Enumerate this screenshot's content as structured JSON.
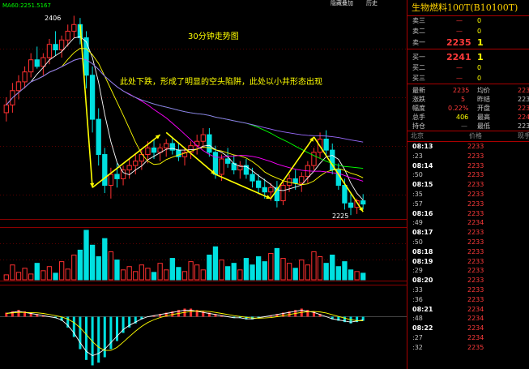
{
  "main_chart": {
    "ma_label": "MA60:2251.5167",
    "period_label": "30分钟走势图",
    "note": "此处下跌，形成了明显的空头陷阱，此处以小井形态出现",
    "high_label": "2406",
    "low_label": "2225",
    "top_buttons": [
      "隐藏叠加",
      "历史"
    ]
  },
  "chart_data": {
    "type": "candlestick",
    "title": "30分钟走势图",
    "annotations": [
      "此处下跌，形成了明显的空头陷阱，此处以小井形态出现",
      "2406",
      "2225",
      "MA60:2251.5167"
    ],
    "ohlc": [
      [
        2318,
        2332,
        2310,
        2325
      ],
      [
        2325,
        2345,
        2318,
        2338
      ],
      [
        2338,
        2352,
        2330,
        2346
      ],
      [
        2346,
        2360,
        2340,
        2355
      ],
      [
        2355,
        2372,
        2350,
        2366
      ],
      [
        2366,
        2378,
        2358,
        2360
      ],
      [
        2360,
        2372,
        2352,
        2368
      ],
      [
        2368,
        2385,
        2362,
        2380
      ],
      [
        2380,
        2392,
        2370,
        2375
      ],
      [
        2375,
        2388,
        2368,
        2384
      ],
      [
        2384,
        2398,
        2378,
        2392
      ],
      [
        2392,
        2406,
        2386,
        2398
      ],
      [
        2398,
        2404,
        2380,
        2386
      ],
      [
        2386,
        2392,
        2340,
        2352
      ],
      [
        2352,
        2360,
        2300,
        2312
      ],
      [
        2312,
        2322,
        2270,
        2280
      ],
      [
        2280,
        2286,
        2245,
        2252
      ],
      [
        2252,
        2268,
        2240,
        2262
      ],
      [
        2262,
        2272,
        2250,
        2258
      ],
      [
        2258,
        2270,
        2252,
        2266
      ],
      [
        2266,
        2276,
        2258,
        2270
      ],
      [
        2270,
        2280,
        2262,
        2274
      ],
      [
        2274,
        2284,
        2266,
        2280
      ],
      [
        2280,
        2292,
        2272,
        2286
      ],
      [
        2286,
        2294,
        2276,
        2282
      ],
      [
        2282,
        2290,
        2274,
        2286
      ],
      [
        2286,
        2294,
        2278,
        2290
      ],
      [
        2290,
        2296,
        2280,
        2284
      ],
      [
        2284,
        2290,
        2274,
        2278
      ],
      [
        2278,
        2286,
        2270,
        2282
      ],
      [
        2282,
        2292,
        2276,
        2288
      ],
      [
        2288,
        2298,
        2280,
        2292
      ],
      [
        2292,
        2304,
        2286,
        2298
      ],
      [
        2298,
        2304,
        2278,
        2282
      ],
      [
        2282,
        2288,
        2258,
        2262
      ],
      [
        2262,
        2280,
        2256,
        2276
      ],
      [
        2276,
        2286,
        2268,
        2272
      ],
      [
        2272,
        2280,
        2262,
        2266
      ],
      [
        2266,
        2274,
        2258,
        2270
      ],
      [
        2270,
        2276,
        2258,
        2262
      ],
      [
        2262,
        2268,
        2250,
        2256
      ],
      [
        2256,
        2262,
        2244,
        2250
      ],
      [
        2250,
        2258,
        2240,
        2246
      ],
      [
        2246,
        2254,
        2238,
        2250
      ],
      [
        2250,
        2256,
        2232,
        2238
      ],
      [
        2238,
        2256,
        2234,
        2252
      ],
      [
        2252,
        2262,
        2246,
        2258
      ],
      [
        2258,
        2266,
        2248,
        2254
      ],
      [
        2254,
        2264,
        2246,
        2260
      ],
      [
        2260,
        2274,
        2254,
        2270
      ],
      [
        2270,
        2286,
        2266,
        2282
      ],
      [
        2282,
        2300,
        2276,
        2294
      ],
      [
        2294,
        2302,
        2280,
        2284
      ],
      [
        2284,
        2290,
        2262,
        2266
      ],
      [
        2266,
        2272,
        2248,
        2252
      ],
      [
        2252,
        2258,
        2230,
        2236
      ],
      [
        2236,
        2244,
        2225,
        2232
      ],
      [
        2232,
        2240,
        2226,
        2238
      ],
      [
        2238,
        2244,
        2230,
        2235
      ]
    ],
    "volume": [
      6,
      18,
      9,
      14,
      7,
      20,
      11,
      16,
      8,
      22,
      13,
      30,
      36,
      60,
      42,
      28,
      50,
      34,
      24,
      12,
      16,
      10,
      18,
      14,
      9,
      20,
      12,
      26,
      15,
      10,
      22,
      18,
      12,
      30,
      40,
      24,
      16,
      20,
      12,
      26,
      18,
      28,
      22,
      32,
      38,
      26,
      20,
      14,
      24,
      18,
      34,
      28,
      20,
      30,
      16,
      22,
      12,
      10,
      8
    ],
    "macd": [
      3,
      4,
      5,
      4,
      3,
      2,
      1,
      0,
      -1,
      -3,
      -8,
      -15,
      -24,
      -32,
      -36,
      -34,
      -30,
      -24,
      -18,
      -12,
      -8,
      -5,
      -2,
      0,
      1,
      2,
      3,
      4,
      5,
      6,
      6,
      5,
      4,
      3,
      2,
      1,
      0,
      -1,
      -1,
      -2,
      -2,
      -1,
      0,
      1,
      2,
      3,
      4,
      5,
      6,
      5,
      4,
      2,
      0,
      -2,
      -3,
      -4,
      -5,
      -4,
      -3
    ],
    "ylim": [
      2220,
      2410
    ],
    "grid": true
  },
  "panel": {
    "title": "生物燃料100T(B10100T)",
    "asks": [
      {
        "label": "卖三",
        "price": "—",
        "vol": "0"
      },
      {
        "label": "卖二",
        "price": "—",
        "vol": "0"
      },
      {
        "label": "卖一",
        "price": "2235",
        "vol": "1"
      }
    ],
    "bids": [
      {
        "label": "买一",
        "price": "2241",
        "vol": "1"
      },
      {
        "label": "买二",
        "price": "—",
        "vol": "0"
      },
      {
        "label": "买三",
        "price": "—",
        "vol": "0"
      }
    ],
    "stats": [
      {
        "l1": "最新",
        "v1": "2235",
        "l2": "均价",
        "v2": "223"
      },
      {
        "l1": "涨跌",
        "v1": "5",
        "l2": "昨结",
        "v2": "223"
      },
      {
        "l1": "幅度",
        "v1": "0.22%",
        "l2": "开盘",
        "v2": "223"
      },
      {
        "l1": "总手",
        "v1": "406",
        "l2": "最高",
        "v2": "224"
      },
      {
        "l1": "持仓",
        "v1": "—",
        "l2": "最低",
        "v2": "223"
      }
    ],
    "ticks_header": [
      "北京",
      "价格",
      "现手"
    ],
    "ticks": [
      {
        "t": "08:13",
        "p": "2233"
      },
      {
        "t": ":23",
        "p": "2233"
      },
      {
        "t": "08:14",
        "p": "2233"
      },
      {
        "t": ":50",
        "p": "2233"
      },
      {
        "t": "08:15",
        "p": "2233"
      },
      {
        "t": ":35",
        "p": "2233"
      },
      {
        "t": ":57",
        "p": "2233"
      },
      {
        "t": "08:16",
        "p": "2233"
      },
      {
        "t": ":49",
        "p": "2234"
      },
      {
        "t": "08:17",
        "p": "2233"
      },
      {
        "t": ":50",
        "p": "2233"
      },
      {
        "t": "08:18",
        "p": "2233"
      },
      {
        "t": "08:19",
        "p": "2233"
      },
      {
        "t": ":29",
        "p": "2233"
      },
      {
        "t": "08:20",
        "p": "2233"
      },
      {
        "t": ":33",
        "p": "2233"
      },
      {
        "t": ":36",
        "p": "2233"
      },
      {
        "t": "08:21",
        "p": "2234"
      },
      {
        "t": ":48",
        "p": "2234"
      },
      {
        "t": "08:22",
        "p": "2234"
      },
      {
        "t": ":27",
        "p": "2234"
      },
      {
        "t": ":32",
        "p": "2235"
      }
    ]
  }
}
